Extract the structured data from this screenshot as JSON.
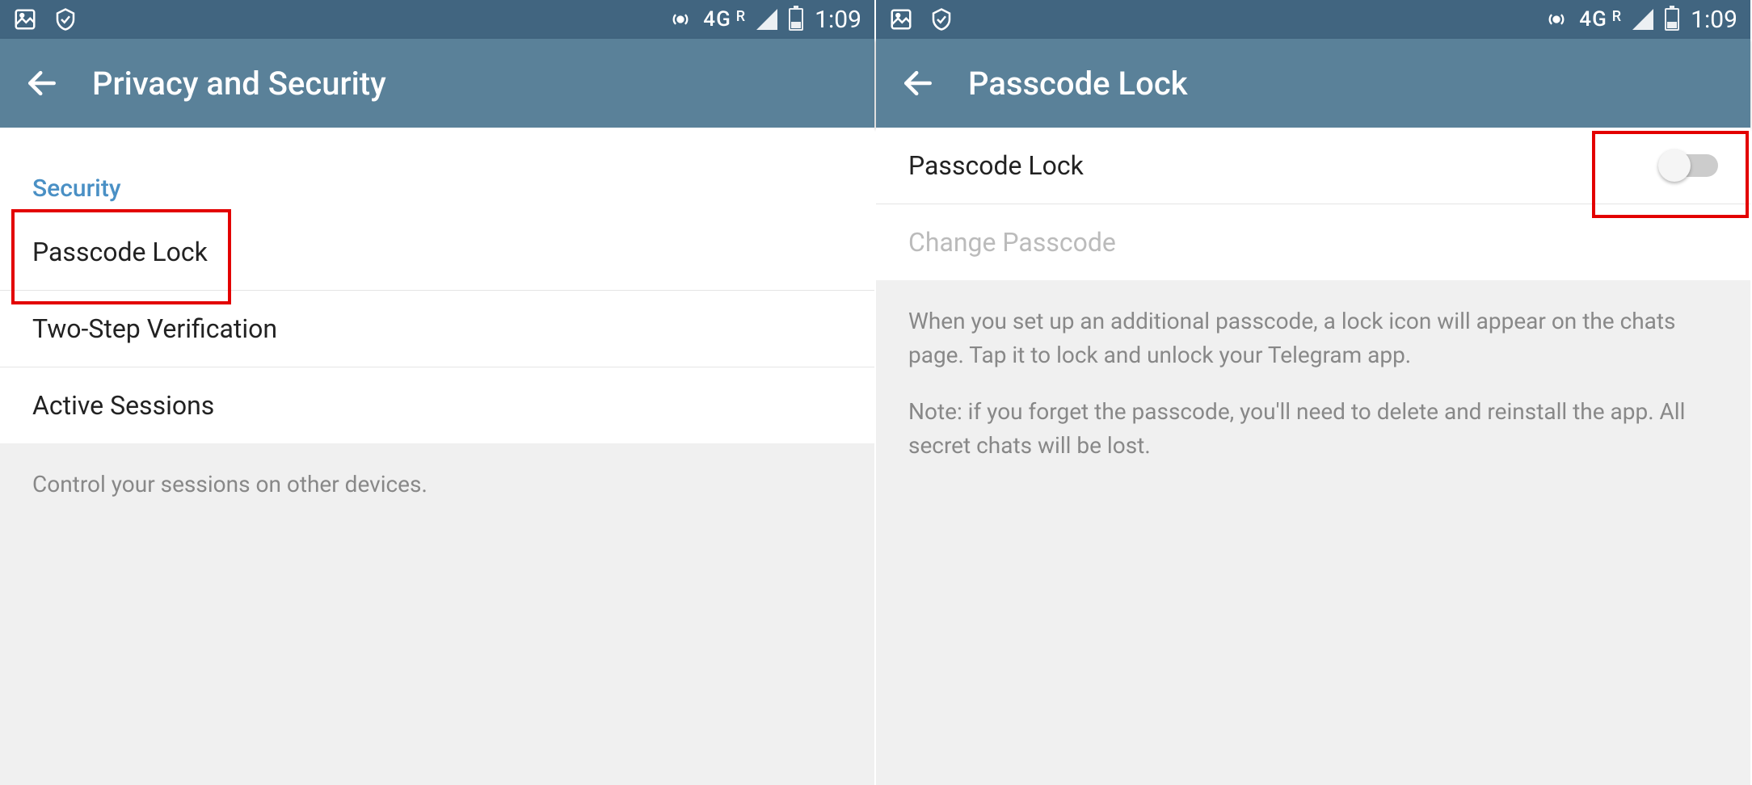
{
  "status": {
    "net_label": "4G",
    "roaming": "R",
    "time": "1:09"
  },
  "screen1": {
    "title": "Privacy and Security",
    "section_header": "Security",
    "items": [
      {
        "label": "Passcode Lock"
      },
      {
        "label": "Two-Step Verification"
      },
      {
        "label": "Active Sessions"
      }
    ],
    "footer": "Control your sessions on other devices."
  },
  "screen2": {
    "title": "Passcode Lock",
    "toggle_label": "Passcode Lock",
    "change_label": "Change Passcode",
    "help_p1": "When you set up an additional passcode, a lock icon will appear on the chats page. Tap it to lock and unlock your Telegram app.",
    "help_p2": "Note: if you forget the passcode, you'll need to delete and reinstall the app. All secret chats will be lost."
  }
}
